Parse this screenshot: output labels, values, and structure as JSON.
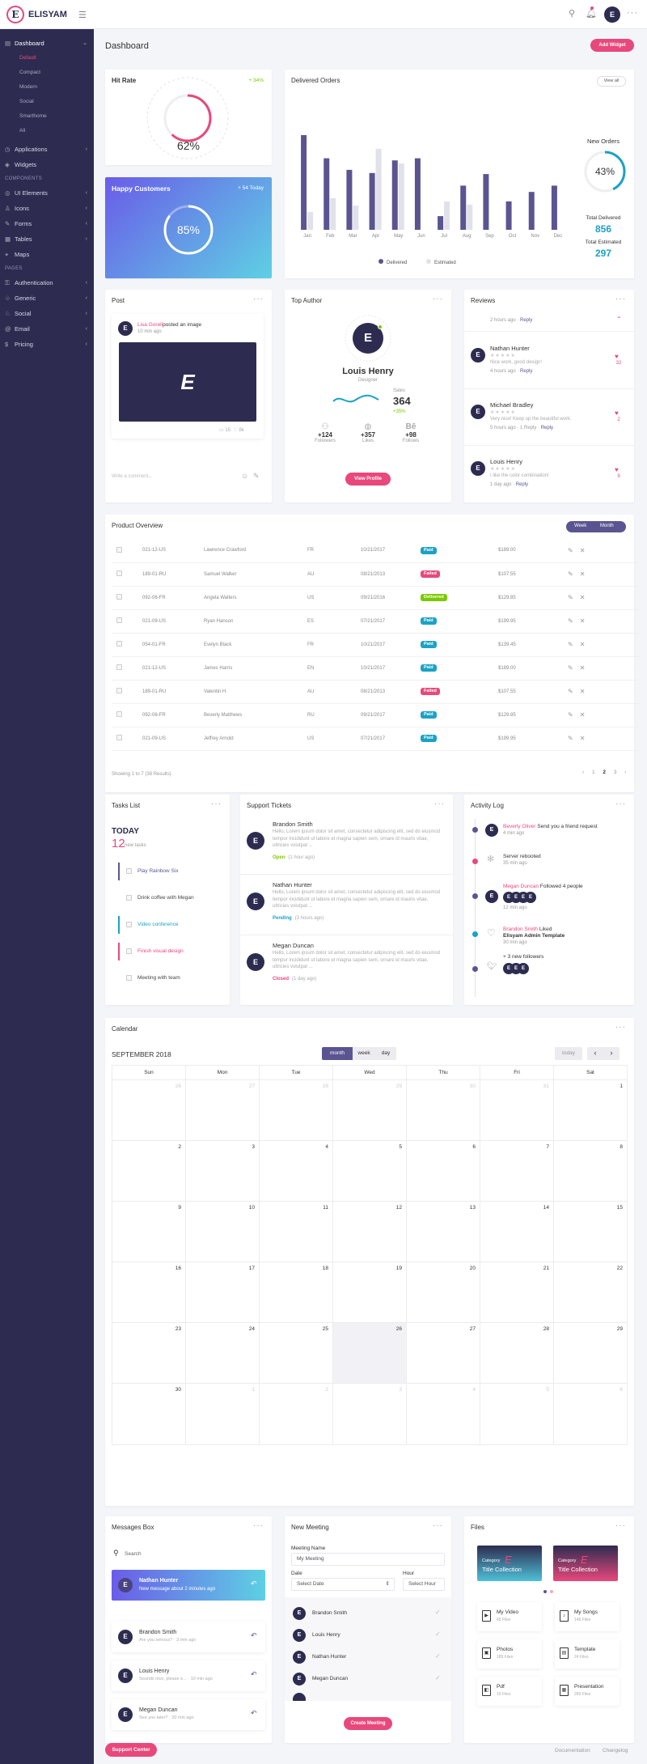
{
  "app": {
    "name": "ELISYAM",
    "logo_letter": "E",
    "avatar_letter": "E"
  },
  "colors": {
    "accent": "#e8487c",
    "primary": "#5a5591",
    "sidebar": "#2d2c50",
    "info": "#1ba2c4",
    "success": "#7bc900"
  },
  "sidebar": {
    "items": [
      {
        "label": "Dashboard",
        "icon": "dashboard-icon"
      },
      {
        "label": "Applications",
        "icon": "apps-icon"
      },
      {
        "label": "Widgets",
        "icon": "widgets-icon"
      },
      {
        "label": "UI Elements",
        "icon": "ui-icon"
      },
      {
        "label": "Icons",
        "icon": "icons-icon"
      },
      {
        "label": "Forms",
        "icon": "forms-icon"
      },
      {
        "label": "Tables",
        "icon": "tables-icon"
      },
      {
        "label": "Maps",
        "icon": "maps-icon"
      },
      {
        "label": "Authentication",
        "icon": "lock-icon"
      },
      {
        "label": "Generic",
        "icon": "generic-icon"
      },
      {
        "label": "Social",
        "icon": "social-icon"
      },
      {
        "label": "Email",
        "icon": "email-icon"
      },
      {
        "label": "Pricing",
        "icon": "pricing-icon"
      }
    ],
    "subitems": [
      "Default",
      "Compact",
      "Modern",
      "Social",
      "Smarthome",
      "All"
    ],
    "sections": [
      "COMPONENTS",
      "PAGES"
    ]
  },
  "header": {
    "title": "Dashboard",
    "add_widget": "Add Widget"
  },
  "hit_rate": {
    "title": "Hit Rate",
    "change": "+ 34%",
    "value": "62%",
    "pct": 62
  },
  "happy": {
    "title": "Happy Customers",
    "change": "+ 54 Today",
    "value": "85%",
    "pct": 85
  },
  "delivered": {
    "title": "Delivered Orders",
    "view_all": "View all",
    "new_orders_label": "New Orders",
    "new_orders_value": "43%",
    "new_orders_pct": 43,
    "total_delivered_label": "Total Delivered",
    "total_delivered": "856",
    "total_estimated_label": "Total Estimated",
    "total_estimated": "297",
    "legend": [
      "Delivered",
      "Estimated"
    ]
  },
  "chart_data": {
    "type": "bar",
    "categories": [
      "Jan",
      "Feb",
      "Mar",
      "Apr",
      "May",
      "Jun",
      "Jul",
      "Aug",
      "Sep",
      "Oct",
      "Nov",
      "Dec"
    ],
    "series": [
      {
        "name": "Delivered",
        "values": [
          90,
          68,
          57,
          54,
          66,
          68,
          13,
          42,
          53,
          27,
          36,
          42
        ]
      },
      {
        "name": "Estimated",
        "values": [
          17,
          30,
          23,
          77,
          63,
          0,
          27,
          24,
          0,
          0,
          0,
          0
        ]
      }
    ],
    "legend": "bottom",
    "ylim": [
      0,
      100
    ]
  },
  "post": {
    "title": "Post",
    "author": "Lisa Gorell",
    "action": "posted an image",
    "time": "10 min ago",
    "image_letter": "E",
    "comments": "15",
    "likes": "8k",
    "placeholder": "Write a comment..."
  },
  "top_author": {
    "title": "Top Author",
    "name": "Louis Henry",
    "role": "Designer",
    "sales_label": "Sales",
    "sales": "364",
    "sales_change": "+35%",
    "followers": "+124",
    "followers_label": "Followers",
    "likes": "+357",
    "likes_label": "Likes",
    "following": "+98",
    "following_label": "Follows",
    "button": "View Profile"
  },
  "reviews": {
    "title": "Reviews",
    "top_meta": "2 hours ago",
    "reply": "Reply",
    "items": [
      {
        "name": "Nathan Hunter",
        "text": "Nice work, good design!",
        "meta": "4 hours ago",
        "count": "32"
      },
      {
        "name": "Michael Bradley",
        "text": "Very nice! Keep up the beautiful work.",
        "meta": "5 hours ago · 1 Reply",
        "count": "2"
      },
      {
        "name": "Louis Henry",
        "text": "I like the color combination!",
        "meta": "1 day ago",
        "count": "9"
      }
    ]
  },
  "product": {
    "title": "Product Overview",
    "week": "Week",
    "month": "Month",
    "footer": "Showing 1 to 7 (38 Results)",
    "pages": [
      "1",
      "2",
      "3"
    ],
    "rows": [
      {
        "id": "021-12-US",
        "name": "Lawrence Crawford",
        "c": "FR",
        "date": "10/21/2017",
        "status": "Paid",
        "amount": "$189.00"
      },
      {
        "id": "189-01-RU",
        "name": "Samuel Walker",
        "c": "AU",
        "date": "08/21/2013",
        "status": "Failed",
        "amount": "$107.55"
      },
      {
        "id": "092-06-FR",
        "name": "Angela Walters",
        "c": "US",
        "date": "09/21/2016",
        "status": "Delivered",
        "amount": "$129.85"
      },
      {
        "id": "021-09-US",
        "name": "Ryan Hanson",
        "c": "ES",
        "date": "07/21/2017",
        "status": "Paid",
        "amount": "$199.95"
      },
      {
        "id": "054-01-FR",
        "name": "Evelyn Black",
        "c": "FR",
        "date": "10/21/2017",
        "status": "Paid",
        "amount": "$139.45"
      },
      {
        "id": "021-12-US",
        "name": "James Harris",
        "c": "EN",
        "date": "10/21/2017",
        "status": "Paid",
        "amount": "$189.00"
      },
      {
        "id": "189-01-RU",
        "name": "Valentin H.",
        "c": "AU",
        "date": "08/21/2013",
        "status": "Failed",
        "amount": "$107.55"
      },
      {
        "id": "092-06-FR",
        "name": "Beverly Matthews",
        "c": "RU",
        "date": "09/21/2017",
        "status": "Paid",
        "amount": "$129.85"
      },
      {
        "id": "021-09-US",
        "name": "Jeffrey Arnold",
        "c": "US",
        "date": "07/21/2017",
        "status": "Paid",
        "amount": "$199.95"
      }
    ]
  },
  "tasks": {
    "title": "Tasks List",
    "today": "TODAY",
    "count": "12",
    "count_label": "new tasks",
    "items": [
      "Play Rainbow Six",
      "Drink coffee with Megan",
      "Video conference",
      "Finish visual design",
      "Meeting with team"
    ]
  },
  "tickets": {
    "title": "Support Tickets",
    "items": [
      {
        "name": "Brandon Smith",
        "text": "Hello, Lorem ipsum dolor sit amet, consectetur adipiscing elit, sed do eiusmod tempor incididunt ut labore et magna sapien sem, ornare id mauris vitae, ultricies volutpat ...",
        "status": "Open",
        "time": "(1 hour ago)"
      },
      {
        "name": "Nathan Hunter",
        "text": "Hello, Lorem ipsum dolor sit amet, consectetur adipiscing elit, sed do eiusmod tempor incididunt ut labore et magna sapien sem, ornare id mauris vitae, ultricies volutpat ...",
        "status": "Pending",
        "time": "(3 hours ago)"
      },
      {
        "name": "Megan Duncan",
        "text": "Hello, Lorem ipsum dolor sit amet, consectetur adipiscing elit, sed do eiusmod tempor incididunt ut labore et magna sapien sem, ornare id mauris vitae, ultricies volutpat ...",
        "status": "Closed",
        "time": "(1 day ago)"
      }
    ]
  },
  "activity": {
    "title": "Activity Log",
    "a1_name": "Beverly Oliver",
    "a1_text": "Send you a friend request",
    "a1_time": "4 min ago",
    "a2_text": "Server rebooted",
    "a2_time": "35 min ago",
    "a3_name": "Megan Duncan",
    "a3_text": "Followed 4 people",
    "a3_time": "12 min ago",
    "a4_name": "Brandon Smith",
    "a4_text": "Liked",
    "a4_target": "Elisyam Admin Template",
    "a4_time": "30 min ago",
    "a5_text": "+ 3 new followers"
  },
  "calendar": {
    "title": "Calendar",
    "month": "SEPTEMBER 2018",
    "views": [
      "month",
      "week",
      "day"
    ],
    "today": "today",
    "days": [
      "Sun",
      "Mon",
      "Tue",
      "Wed",
      "Thu",
      "Fri",
      "Sat"
    ],
    "weeks": [
      [
        "26",
        "27",
        "28",
        "29",
        "30",
        "31",
        "1"
      ],
      [
        "2",
        "3",
        "4",
        "5",
        "6",
        "7",
        "8"
      ],
      [
        "9",
        "10",
        "11",
        "12",
        "13",
        "14",
        "15"
      ],
      [
        "16",
        "17",
        "18",
        "19",
        "20",
        "21",
        "22"
      ],
      [
        "23",
        "24",
        "25",
        "26",
        "27",
        "28",
        "29"
      ],
      [
        "30",
        "1",
        "2",
        "3",
        "4",
        "5",
        "6"
      ]
    ]
  },
  "messages": {
    "title": "Messages Box",
    "search": "Search",
    "highlight_name": "Nathan Hunter",
    "highlight_text": "New message about 2 minutes ago",
    "items": [
      {
        "name": "Brandon Smith",
        "text": "Are you serious? · 3 min ago"
      },
      {
        "name": "Louis Henry",
        "text": "Sounds nice, please e... · 10 min ago"
      },
      {
        "name": "Megan Duncan",
        "text": "See you later? · 20 min ago"
      }
    ]
  },
  "meeting": {
    "title": "New Meeting",
    "name_label": "Meeting Name",
    "name_value": "My Meeting",
    "date_label": "Date",
    "date_value": "Select Date",
    "hour_label": "Hour",
    "hour_value": "Select Hour",
    "people": [
      "Brandon Smith",
      "Louis Henry",
      "Nathan Hunter",
      "Megan Duncan"
    ],
    "button": "Create Meeting"
  },
  "files": {
    "title": "Files",
    "cat1": "Category",
    "cat1_title": "Title Collection",
    "cat2": "Category",
    "cat2_title": "Title Collection",
    "items": [
      {
        "name": "My Video",
        "count": "65 Files"
      },
      {
        "name": "My Songs",
        "count": "146 Files"
      },
      {
        "name": "Photos",
        "count": "189 Files"
      },
      {
        "name": "Template",
        "count": "24 Files"
      },
      {
        "name": "Pdf",
        "count": "15 Files"
      },
      {
        "name": "Presentation",
        "count": "260 Files"
      }
    ]
  },
  "footer": {
    "support": "Support Center",
    "documentation": "Documentation",
    "changelog": "Changelog"
  }
}
